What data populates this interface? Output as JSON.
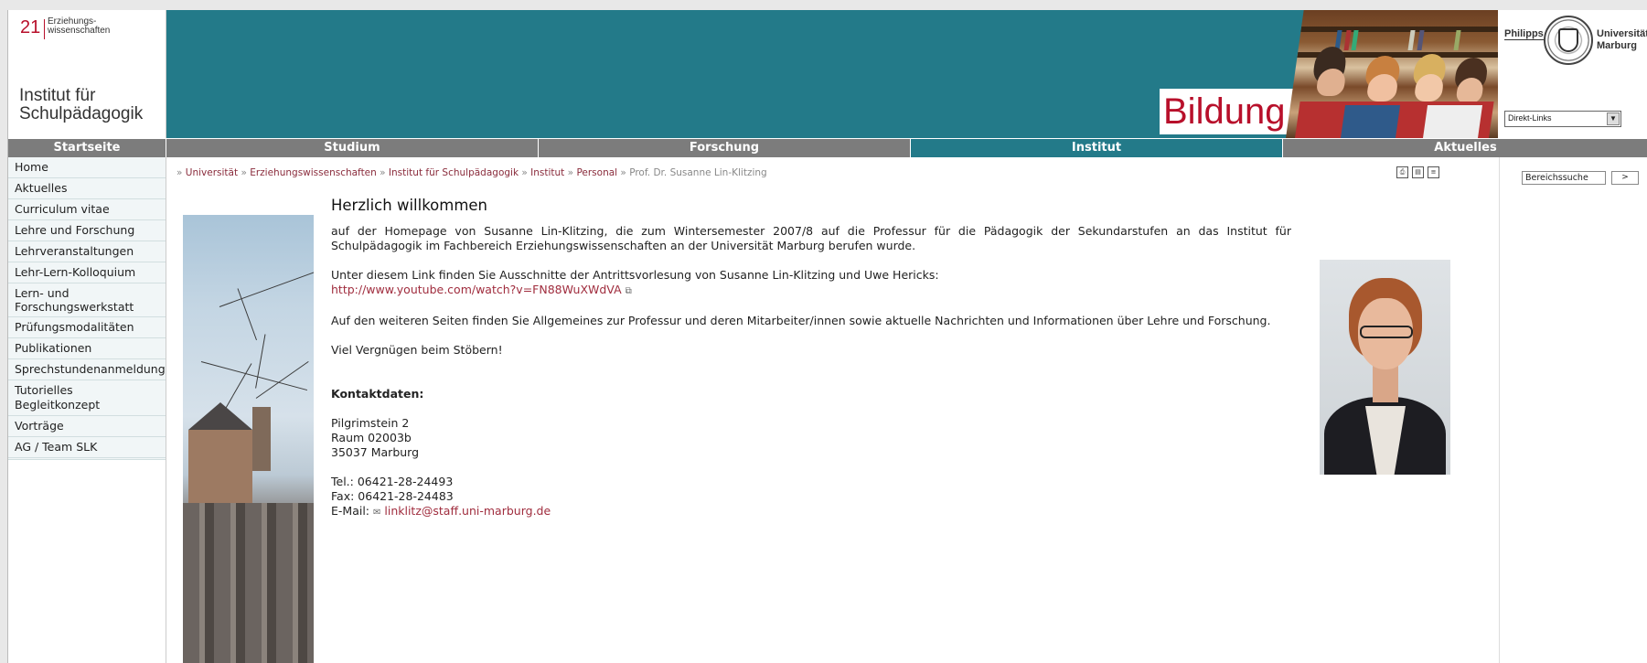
{
  "header": {
    "faculty_number": "21",
    "faculty_name": "Erziehungs-\nwissenschaften",
    "institute_name": "Institut für\nSchulpädagogik",
    "banner_word": "Bildung.",
    "uni_philipps": "Philipps",
    "uni_name": "Universität\nMarburg",
    "direkt_links": "Direkt-Links",
    "direkt_arrow": "▼"
  },
  "nav": [
    {
      "label": "Startseite",
      "active": false
    },
    {
      "label": "Studium",
      "active": false
    },
    {
      "label": "Forschung",
      "active": false
    },
    {
      "label": "Institut",
      "active": true
    },
    {
      "label": "Aktuelles",
      "active": false
    }
  ],
  "leftmenu": [
    "Home",
    "Aktuelles",
    "Curriculum vitae",
    "Lehre und Forschung",
    "Lehrveranstaltungen",
    "Lehr-Lern-Kolloquium",
    "Lern- und\nForschungswerkstatt",
    "Prüfungsmodalitäten",
    "Publikationen",
    "Sprechstundenanmeldung",
    "Tutorielles Begleitkonzept",
    "Vorträge",
    "AG / Team SLK"
  ],
  "breadcrumb": {
    "sep": "»",
    "items": [
      "Universität",
      "Erziehungswissenschaften",
      "Institut für Schulpädagogik",
      "Institut",
      "Personal"
    ],
    "current": "Prof. Dr. Susanne Lin-Klitzing"
  },
  "tools": [
    "print-icon",
    "pdf-icon",
    "text-icon"
  ],
  "content": {
    "title": "Herzlich willkommen",
    "intro": "auf der Homepage von Susanne Lin-Klitzing, die zum Wintersemester 2007/8 auf die Professur für die Pädagogik der Sekundarstufen an das Institut für Schulpädagogik im Fachbereich Erziehungswissenschaften an der Universität Marburg berufen wurde.",
    "video_text": "Unter diesem Link finden Sie Ausschnitte der Antrittsvorlesung von Susanne Lin-Klitzing und Uwe Hericks:",
    "video_link": "http://www.youtube.com/watch?v=FN88WuXWdVA",
    "info": "Auf den weiteren Seiten finden Sie Allgemeines zur Professur und deren Mitarbeiter/innen sowie aktuelle Nachrichten und Informationen über Lehre und Forschung.",
    "closing": "Viel Vergnügen beim Stöbern!",
    "contact_head": "Kontaktdaten:",
    "address": [
      "Pilgrimstein 2",
      "Raum 02003b",
      "35037 Marburg"
    ],
    "tel": "Tel.: 06421-28-24493",
    "fax": "Fax: 06421-28-24483",
    "email_label": "E-Mail:",
    "email": "linklitz@staff.uni-marburg.de"
  },
  "search": {
    "value": "Bereichssuche",
    "button": ">"
  },
  "colors": {
    "teal": "#237a89",
    "nav_gray": "#7c7c7c",
    "accent_red": "#b8102b",
    "link": "#a02d3e"
  }
}
